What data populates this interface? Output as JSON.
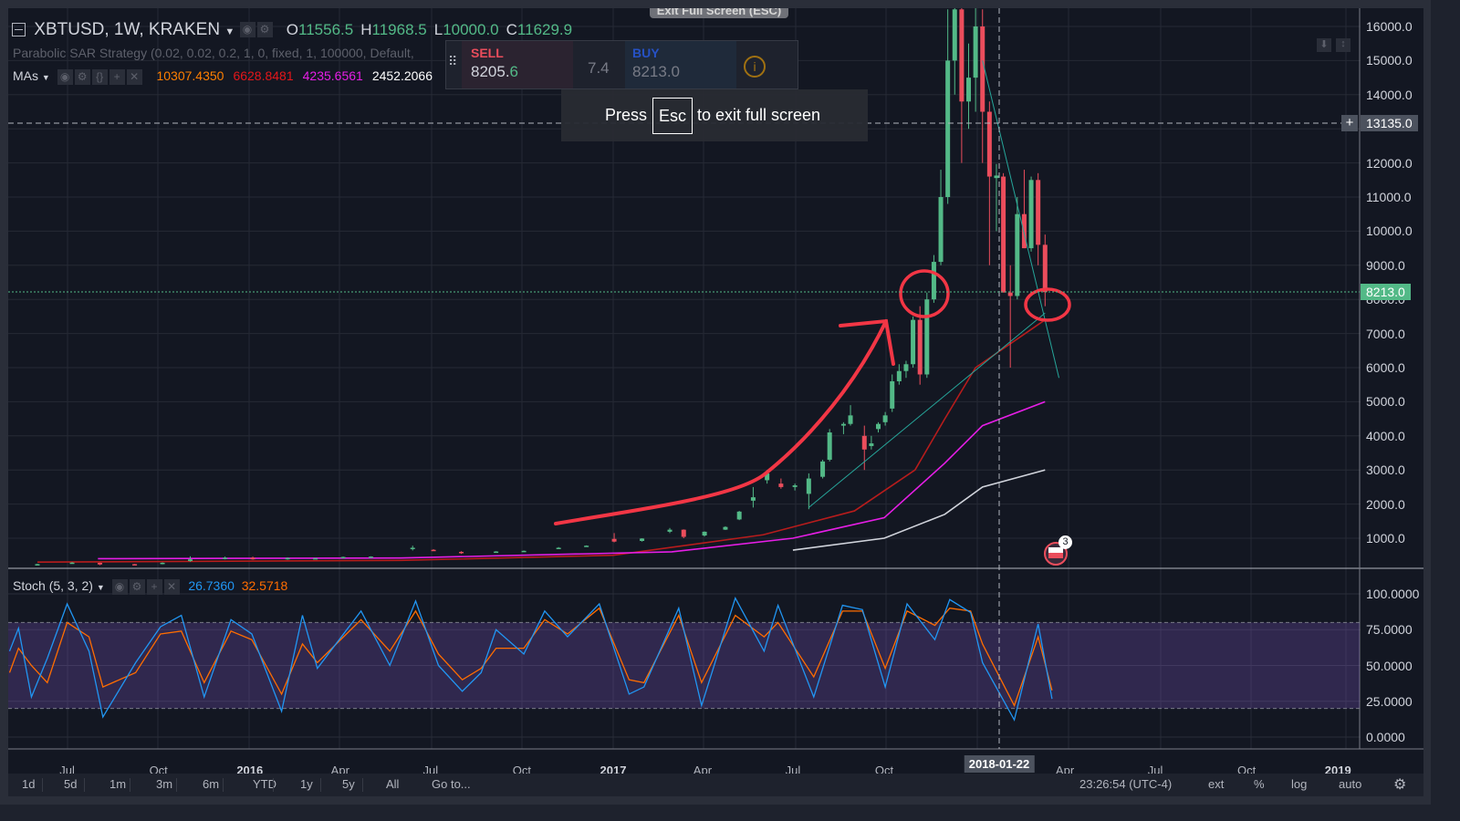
{
  "header": {
    "symbol": "XBTUSD, 1W, KRAKEN",
    "ohlc": [
      {
        "label": "O",
        "value": "11556.5"
      },
      {
        "label": "H",
        "value": "11968.5"
      },
      {
        "label": "L",
        "value": "10000.0"
      },
      {
        "label": "C",
        "value": "11629.9"
      }
    ],
    "strategy": "Parabolic SAR Strategy (0.02, 0.02, 0.2, 1, 0, fixed, 1, 100000, Default,",
    "mas_label": "MAs",
    "ma_values": [
      {
        "value": "10307.4350",
        "color": "#ff7f00"
      },
      {
        "value": "6628.8481",
        "color": "#e5161a"
      },
      {
        "value": "4235.6561",
        "color": "#e61ee6"
      },
      {
        "value": "2452.2066",
        "color": "#ffffff"
      }
    ]
  },
  "trade_widget": {
    "sell_label": "SELL",
    "sell_price_main": "8205.",
    "sell_price_last": "6",
    "spread": "7.4",
    "buy_label": "BUY",
    "buy_price": "8213.0"
  },
  "fullscreen": {
    "exit_tab": "Exit Full Screen (ESC)",
    "press": "Press",
    "key": "Esc",
    "message": "to exit full screen"
  },
  "stoch_legend": {
    "label": "Stoch (5, 3, 2)",
    "k": "26.7360",
    "d": "32.5718",
    "k_color": "#2196f3",
    "d_color": "#ff6d00"
  },
  "price_axis": {
    "ticks": [
      "16000.0",
      "15000.0",
      "14000.0",
      "12000.0",
      "11000.0",
      "10000.0",
      "9000.0",
      "8000.0",
      "7000.0",
      "6000.0",
      "5000.0",
      "4000.0",
      "3000.0",
      "2000.0",
      "1000.0"
    ],
    "crosshair_price": "13135.0",
    "last_price": "8213.0",
    "last_price_color": "#53b987"
  },
  "stoch_axis": {
    "ticks": [
      "100.0000",
      "75.0000",
      "50.0000",
      "25.0000",
      "0.0000"
    ]
  },
  "time_axis": {
    "ticks": [
      {
        "label": "Jul",
        "date": "2015-07-01",
        "bold": false
      },
      {
        "label": "Oct",
        "date": "2015-10-01",
        "bold": false
      },
      {
        "label": "2016",
        "date": "2016-01-01",
        "bold": true
      },
      {
        "label": "Apr",
        "date": "2016-04-01",
        "bold": false
      },
      {
        "label": "Jul",
        "date": "2016-07-01",
        "bold": false
      },
      {
        "label": "Oct",
        "date": "2016-10-01",
        "bold": false
      },
      {
        "label": "2017",
        "date": "2017-01-01",
        "bold": true
      },
      {
        "label": "Apr",
        "date": "2017-04-01",
        "bold": false
      },
      {
        "label": "Jul",
        "date": "2017-07-01",
        "bold": false
      },
      {
        "label": "Oct",
        "date": "2017-10-01",
        "bold": false
      },
      {
        "label": "Apr",
        "date": "2018-04-01",
        "bold": false
      },
      {
        "label": "Jul",
        "date": "2018-07-01",
        "bold": false
      },
      {
        "label": "Oct",
        "date": "2018-10-01",
        "bold": false
      },
      {
        "label": "2019",
        "date": "2019-01-01",
        "bold": true
      }
    ],
    "crosshair_date": "2018-01-22"
  },
  "toolbar": {
    "ranges": [
      "1d",
      "5d",
      "1m",
      "3m",
      "6m",
      "YTD",
      "1y",
      "5y",
      "All"
    ],
    "goto": "Go to...",
    "clock": "23:26:54 (UTC-4)",
    "ext": "ext",
    "percent": "%",
    "log": "log",
    "auto": "auto"
  },
  "event_badge": "3",
  "chart_data": {
    "type": "candlestick",
    "ylim": [
      0,
      16500
    ],
    "candle_colors": {
      "up": "#53b987",
      "down": "#eb4d5c"
    },
    "candles": [
      [
        "2015-06-01",
        230,
        250,
        220,
        240
      ],
      [
        "2015-07-06",
        270,
        300,
        260,
        285
      ],
      [
        "2015-08-03",
        280,
        285,
        210,
        230
      ],
      [
        "2015-09-07",
        240,
        245,
        225,
        235
      ],
      [
        "2015-10-05",
        240,
        290,
        235,
        280
      ],
      [
        "2015-11-02",
        330,
        470,
        310,
        380
      ],
      [
        "2015-12-07",
        390,
        460,
        380,
        430
      ],
      [
        "2016-01-04",
        430,
        460,
        370,
        380
      ],
      [
        "2016-02-08",
        380,
        440,
        370,
        420
      ],
      [
        "2016-03-07",
        410,
        420,
        400,
        415
      ],
      [
        "2016-04-04",
        420,
        460,
        415,
        450
      ],
      [
        "2016-05-02",
        450,
        470,
        440,
        460
      ],
      [
        "2016-06-13",
        680,
        780,
        640,
        720
      ],
      [
        "2016-07-04",
        660,
        680,
        640,
        650
      ],
      [
        "2016-08-01",
        600,
        620,
        540,
        580
      ],
      [
        "2016-09-05",
        600,
        620,
        590,
        610
      ],
      [
        "2016-10-03",
        610,
        640,
        600,
        630
      ],
      [
        "2016-11-07",
        700,
        740,
        690,
        720
      ],
      [
        "2016-12-05",
        760,
        790,
        750,
        780
      ],
      [
        "2017-01-02",
        980,
        1150,
        880,
        900
      ],
      [
        "2017-01-30",
        920,
        1000,
        900,
        990
      ],
      [
        "2017-02-27",
        1190,
        1300,
        1150,
        1250
      ],
      [
        "2017-03-13",
        1250,
        1260,
        1000,
        1040
      ],
      [
        "2017-04-03",
        1080,
        1200,
        1050,
        1190
      ],
      [
        "2017-04-24",
        1250,
        1350,
        1240,
        1330
      ],
      [
        "2017-05-08",
        1550,
        1800,
        1530,
        1780
      ],
      [
        "2017-05-22",
        2100,
        2500,
        1900,
        2200
      ],
      [
        "2017-06-05",
        2700,
        3000,
        2600,
        2900
      ],
      [
        "2017-06-19",
        2600,
        2750,
        2450,
        2500
      ],
      [
        "2017-07-03",
        2500,
        2600,
        2400,
        2550
      ],
      [
        "2017-07-17",
        2300,
        2900,
        1850,
        2750
      ],
      [
        "2017-07-31",
        2800,
        3300,
        2750,
        3250
      ],
      [
        "2017-08-07",
        3300,
        4200,
        3250,
        4100
      ],
      [
        "2017-08-21",
        4300,
        4400,
        4050,
        4350
      ],
      [
        "2017-08-28",
        4350,
        4900,
        4300,
        4600
      ],
      [
        "2017-09-11",
        4000,
        4300,
        3000,
        3600
      ],
      [
        "2017-09-18",
        3700,
        4000,
        3600,
        3780
      ],
      [
        "2017-09-25",
        4200,
        4400,
        4100,
        4350
      ],
      [
        "2017-10-02",
        4400,
        4700,
        4300,
        4600
      ],
      [
        "2017-10-09",
        4800,
        5800,
        4700,
        5600
      ],
      [
        "2017-10-16",
        5600,
        6100,
        5500,
        5900
      ],
      [
        "2017-10-23",
        5900,
        6200,
        5700,
        6100
      ],
      [
        "2017-10-30",
        6100,
        7500,
        6000,
        7400
      ],
      [
        "2017-11-06",
        7400,
        7800,
        5500,
        5800
      ],
      [
        "2017-11-13",
        5800,
        8200,
        5700,
        8000
      ],
      [
        "2017-11-20",
        8000,
        9300,
        7900,
        9100
      ],
      [
        "2017-11-27",
        9100,
        11800,
        9000,
        11000
      ],
      [
        "2017-12-04",
        11000,
        16500,
        10800,
        15000
      ],
      [
        "2017-12-11",
        15000,
        17500,
        14000,
        16500
      ],
      [
        "2017-12-18",
        16500,
        17000,
        12000,
        13800
      ],
      [
        "2017-12-25",
        13800,
        15500,
        13000,
        14500
      ],
      [
        "2018-01-01",
        14500,
        17200,
        13500,
        16000
      ],
      [
        "2018-01-08",
        16000,
        16500,
        12000,
        13500
      ],
      [
        "2018-01-15",
        13500,
        13800,
        9000,
        11600
      ],
      [
        "2018-01-22",
        11556.5,
        11968.5,
        10000,
        11629.9
      ],
      [
        "2018-01-29",
        11600,
        11700,
        8500,
        8200
      ],
      [
        "2018-02-05",
        8200,
        9000,
        6000,
        8100
      ],
      [
        "2018-02-12",
        8100,
        11000,
        8000,
        10500
      ],
      [
        "2018-02-19",
        10500,
        11800,
        9500,
        9500
      ],
      [
        "2018-02-26",
        9500,
        11600,
        9400,
        11500
      ],
      [
        "2018-03-05",
        11500,
        11700,
        9000,
        9600
      ],
      [
        "2018-03-12",
        9600,
        9900,
        7800,
        8213
      ]
    ],
    "moving_averages": [
      {
        "color": "#b71c1c",
        "points": [
          [
            "2015-06-01",
            300
          ],
          [
            "2016-06-01",
            350
          ],
          [
            "2017-01-01",
            500
          ],
          [
            "2017-06-01",
            1100
          ],
          [
            "2017-09-01",
            1800
          ],
          [
            "2017-11-01",
            3000
          ],
          [
            "2017-12-01",
            4500
          ],
          [
            "2018-01-01",
            6000
          ],
          [
            "2018-03-12",
            7400
          ]
        ]
      },
      {
        "color": "#e61ee6",
        "points": [
          [
            "2015-08-01",
            400
          ],
          [
            "2016-06-01",
            420
          ],
          [
            "2017-03-01",
            600
          ],
          [
            "2017-07-01",
            1000
          ],
          [
            "2017-10-01",
            1600
          ],
          [
            "2017-12-01",
            3200
          ],
          [
            "2018-01-08",
            4300
          ],
          [
            "2018-03-12",
            5000
          ]
        ]
      },
      {
        "color": "#d1d4dc",
        "points": [
          [
            "2017-07-01",
            650
          ],
          [
            "2017-10-01",
            1000
          ],
          [
            "2017-12-01",
            1700
          ],
          [
            "2018-01-08",
            2500
          ],
          [
            "2018-03-12",
            3000
          ]
        ]
      }
    ],
    "trendlines": [
      {
        "color": "#26a69a",
        "from": [
          "2017-07-17",
          1900
        ],
        "to": [
          "2018-03-12",
          7600
        ]
      },
      {
        "color": "#26a69a",
        "from": [
          "2018-01-08",
          15000
        ],
        "to": [
          "2018-03-26",
          5700
        ]
      }
    ],
    "stochastic": {
      "ylim": [
        0,
        100
      ],
      "overbought": 80,
      "oversold": 20,
      "points": [
        [
          "2015-05-04",
          60,
          45
        ],
        [
          "2015-05-13",
          76,
          62
        ],
        [
          "2015-05-26",
          28,
          50
        ],
        [
          "2015-06-11",
          55,
          38
        ],
        [
          "2015-07-01",
          93,
          80
        ],
        [
          "2015-07-23",
          60,
          70
        ],
        [
          "2015-08-06",
          14,
          35
        ],
        [
          "2015-09-08",
          52,
          45
        ],
        [
          "2015-10-03",
          77,
          72
        ],
        [
          "2015-10-24",
          85,
          74
        ],
        [
          "2015-11-16",
          28,
          38
        ],
        [
          "2015-12-13",
          82,
          74
        ],
        [
          "2016-01-03",
          72,
          68
        ],
        [
          "2016-02-02",
          18,
          30
        ],
        [
          "2016-02-23",
          85,
          65
        ],
        [
          "2016-03-09",
          48,
          52
        ],
        [
          "2016-04-22",
          88,
          82
        ],
        [
          "2016-05-21",
          50,
          60
        ],
        [
          "2016-06-16",
          95,
          88
        ],
        [
          "2016-07-09",
          50,
          58
        ],
        [
          "2016-08-02",
          32,
          40
        ],
        [
          "2016-08-21",
          45,
          48
        ],
        [
          "2016-09-05",
          75,
          62
        ],
        [
          "2016-10-03",
          58,
          62
        ],
        [
          "2016-10-24",
          88,
          82
        ],
        [
          "2016-11-16",
          70,
          72
        ],
        [
          "2016-12-18",
          93,
          90
        ],
        [
          "2017-01-17",
          30,
          40
        ],
        [
          "2017-02-01",
          35,
          38
        ],
        [
          "2017-03-08",
          90,
          85
        ],
        [
          "2017-03-31",
          22,
          38
        ],
        [
          "2017-05-04",
          97,
          85
        ],
        [
          "2017-06-02",
          60,
          70
        ],
        [
          "2017-06-16",
          92,
          80
        ],
        [
          "2017-07-22",
          28,
          42
        ],
        [
          "2017-08-20",
          92,
          88
        ],
        [
          "2017-09-09",
          89,
          88
        ],
        [
          "2017-10-02",
          35,
          48
        ],
        [
          "2017-10-24",
          93,
          88
        ],
        [
          "2017-11-21",
          68,
          78
        ],
        [
          "2017-12-06",
          96,
          90
        ],
        [
          "2017-12-27",
          87,
          88
        ],
        [
          "2018-01-08",
          52,
          65
        ],
        [
          "2018-02-09",
          12,
          22
        ],
        [
          "2018-03-05",
          79,
          70
        ],
        [
          "2018-03-19",
          26.7,
          32.6
        ]
      ]
    }
  }
}
